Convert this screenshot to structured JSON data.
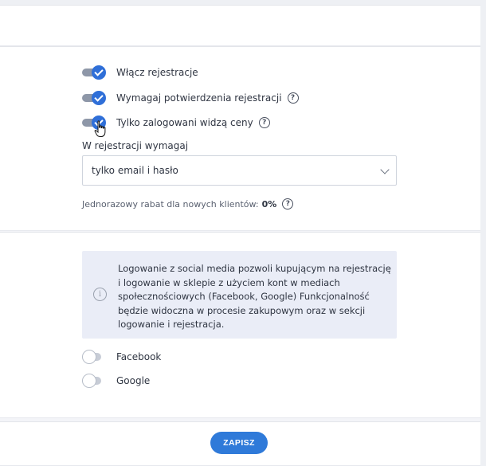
{
  "settings": {
    "toggles": [
      {
        "label": "Włącz rejestracje",
        "checked": true
      },
      {
        "label": "Wymagaj potwierdzenia rejestracji",
        "checked": true
      },
      {
        "label": "Tylko zalogowani widzą ceny",
        "checked": true
      }
    ],
    "help_glyph": "?",
    "registration_requirement": {
      "label": "W rejestracji wymagaj",
      "selected": "tylko email i hasło"
    },
    "discount": {
      "label": "Jednorazowy rabat dla nowych klientów:",
      "value": "0%"
    }
  },
  "social": {
    "info_glyph": "i",
    "info_text": "Logowanie z social media pozwoli kupującym na rejestrację i logowanie w sklepie z użyciem kont w mediach społecznościowych (Facebook, Google) Funkcjonalność będzie widoczna w procesie zakupowym oraz w sekcji logowanie i rejestracja.",
    "providers": [
      {
        "label": "Facebook",
        "checked": false
      },
      {
        "label": "Google",
        "checked": false
      }
    ]
  },
  "footer": {
    "save_label": "ZAPISZ",
    "save_color": "#2f7ad9"
  },
  "colors": {
    "toggle_on": "#2f6fd8",
    "info_bg": "#eaedf7"
  }
}
